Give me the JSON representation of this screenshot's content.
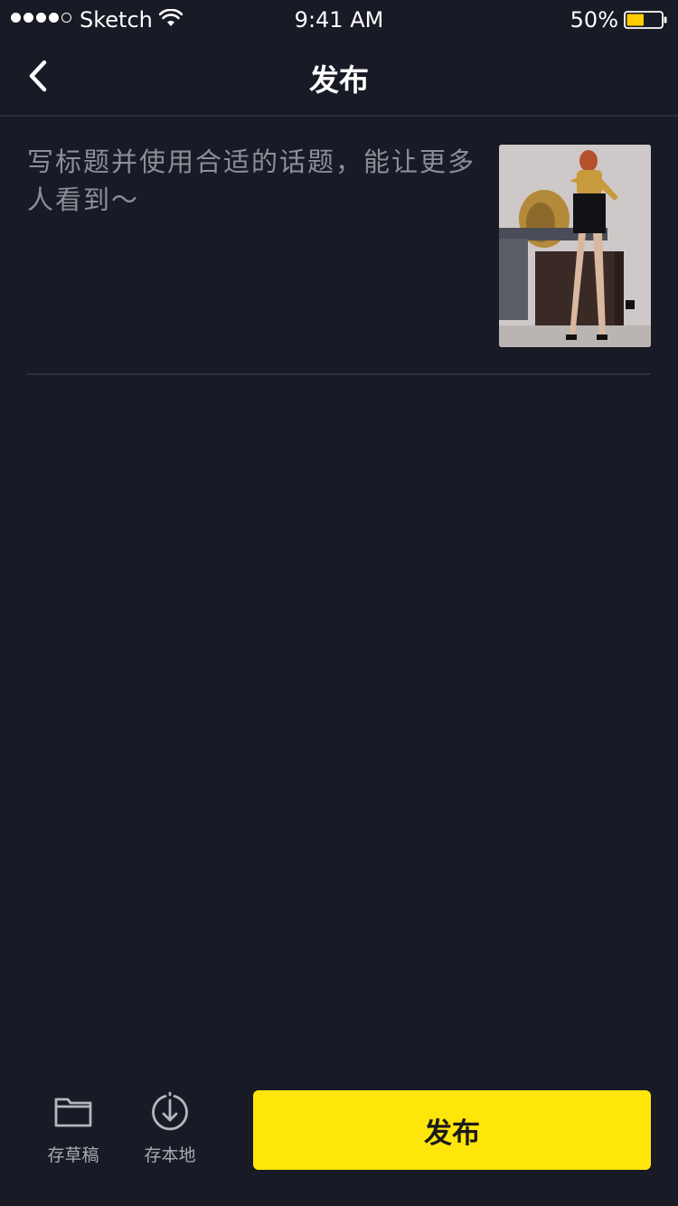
{
  "status_bar": {
    "carrier": "Sketch",
    "time": "9:41 AM",
    "battery_percent": "50%",
    "battery_level": 0.5,
    "icons": [
      "signal-dots-icon",
      "wifi-icon",
      "battery-icon"
    ]
  },
  "nav": {
    "back_icon": "chevron-left-icon",
    "title": "发布"
  },
  "compose": {
    "caption_value": "",
    "caption_placeholder": "写标题并使用合适的话题，能让更多人看到～",
    "thumbnail_icon": "photo-thumbnail"
  },
  "bottom_bar": {
    "draft_label": "存草稿",
    "draft_icon": "folder-icon",
    "save_local_label": "存本地",
    "save_local_icon": "download-icon",
    "publish_label": "发布"
  },
  "colors": {
    "background": "#181a25",
    "accent": "#ffe60a",
    "battery_fill": "#ffcc00",
    "placeholder": "#8c8e98",
    "tool_label": "#a9abb3"
  }
}
